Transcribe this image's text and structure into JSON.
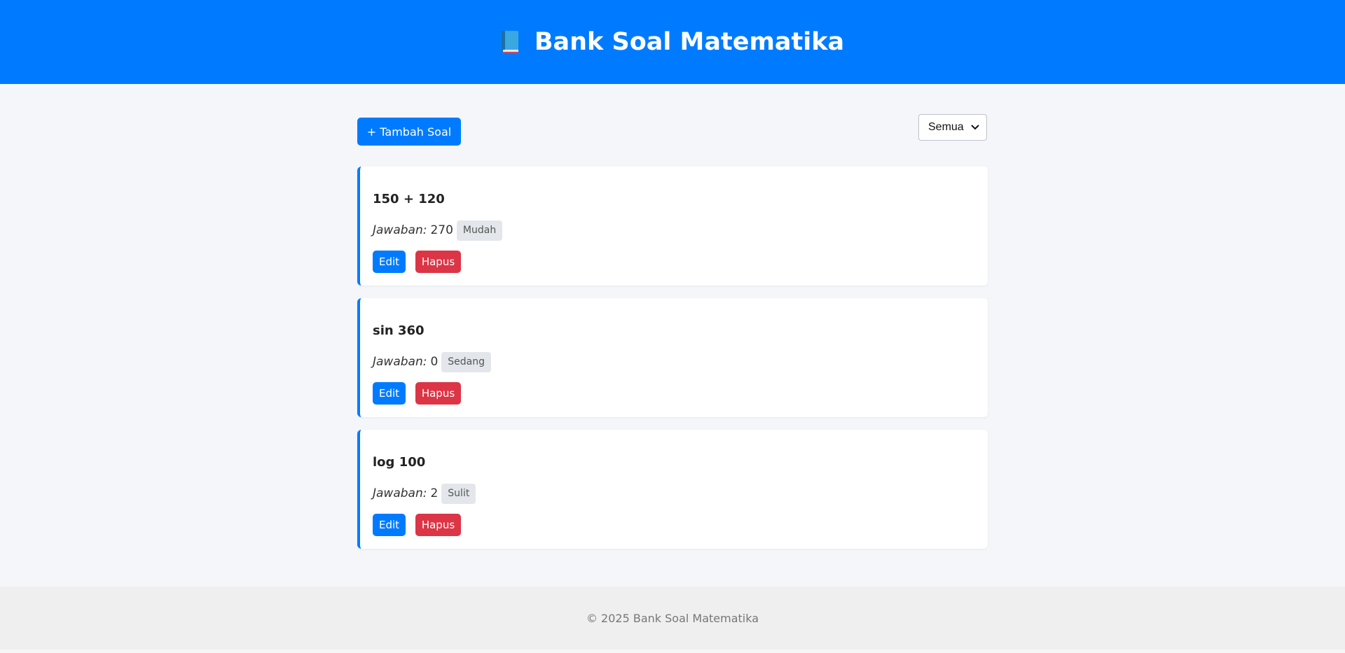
{
  "header": {
    "icon": "book-icon",
    "title": "Bank Soal Matematika"
  },
  "toolbar": {
    "add_label": "+ Tambah Soal",
    "filter_value": "Semua"
  },
  "questions": [
    {
      "question": "150 + 120",
      "answer_label": "Jawaban:",
      "answer": "270",
      "difficulty": "Mudah",
      "edit_label": "Edit",
      "delete_label": "Hapus"
    },
    {
      "question": "sin 360",
      "answer_label": "Jawaban:",
      "answer": "0",
      "difficulty": "Sedang",
      "edit_label": "Edit",
      "delete_label": "Hapus"
    },
    {
      "question": "log 100",
      "answer_label": "Jawaban:",
      "answer": "2",
      "difficulty": "Sulit",
      "edit_label": "Edit",
      "delete_label": "Hapus"
    }
  ],
  "footer": {
    "text": "© 2025 Bank Soal Matematika"
  },
  "colors": {
    "primary": "#007bff",
    "danger": "#dc3545",
    "background": "#f4f6f9",
    "footer_bg": "#efefef"
  }
}
